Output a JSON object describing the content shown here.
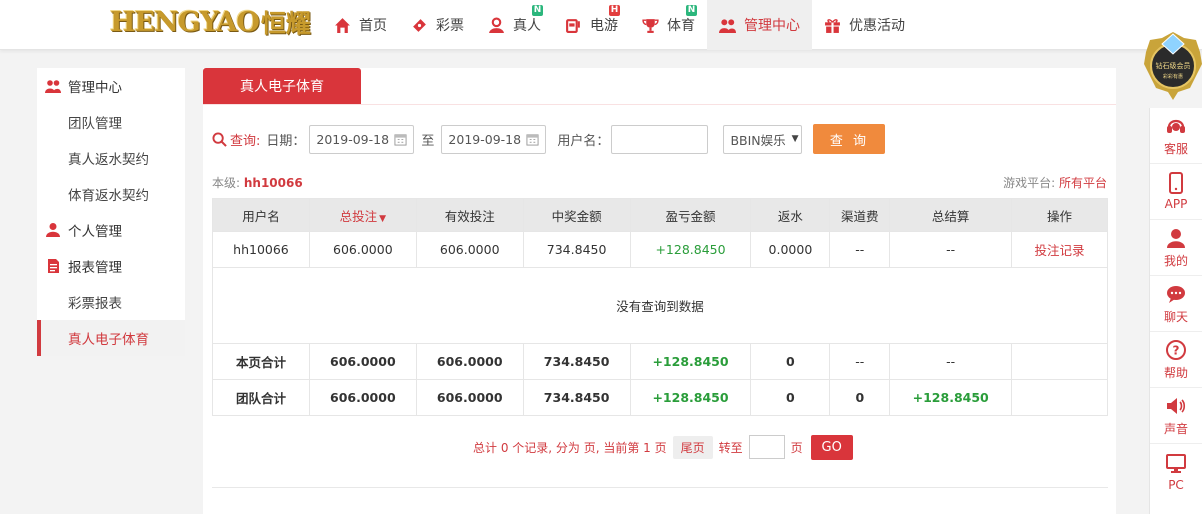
{
  "header": {
    "logo_text": "HENGYAO",
    "logo_cn": "恒耀",
    "nav": [
      {
        "label": "首页",
        "icon": "home-icon",
        "badge": ""
      },
      {
        "label": "彩票",
        "icon": "lottery-ticket-icon",
        "badge": ""
      },
      {
        "label": "真人",
        "icon": "live-dealer-icon",
        "badge": "N"
      },
      {
        "label": "电游",
        "icon": "slot-machine-icon",
        "badge": "H"
      },
      {
        "label": "体育",
        "icon": "trophy-icon",
        "badge": "N"
      },
      {
        "label": "管理中心",
        "icon": "users-icon",
        "badge": "",
        "active": true
      },
      {
        "label": "优惠活动",
        "icon": "gift-icon",
        "badge": ""
      }
    ]
  },
  "vip": {
    "line1": "钻石级会员",
    "line2": "彩彩有惠"
  },
  "sidebar": {
    "items": [
      {
        "label": "管理中心",
        "type": "group",
        "icon": "users-icon"
      },
      {
        "label": "团队管理",
        "type": "sub"
      },
      {
        "label": "真人返水契约",
        "type": "sub"
      },
      {
        "label": "体育返水契约",
        "type": "sub"
      },
      {
        "label": "个人管理",
        "type": "group",
        "icon": "user-icon"
      },
      {
        "label": "报表管理",
        "type": "group",
        "icon": "report-icon"
      },
      {
        "label": "彩票报表",
        "type": "sub"
      },
      {
        "label": "真人电子体育",
        "type": "sub",
        "current": true
      }
    ]
  },
  "main": {
    "tab_title": "真人电子体育",
    "filter": {
      "search_label": "查询:",
      "date_label": "日期：",
      "date_from": "2019-09-18",
      "to_label": "至",
      "date_to": "2019-09-18",
      "username_label": "用户名：",
      "username_value": "",
      "platform_value": "BBIN娱乐",
      "query_button": "查 询"
    },
    "level_label": "本级:",
    "level_value": "hh10066",
    "platform_label": "游戏平台:",
    "platform_all": "所有平台",
    "table": {
      "headers": [
        "用户名",
        "总投注",
        "有效投注",
        "中奖金额",
        "盈亏金额",
        "返水",
        "渠道费",
        "总结算",
        "操作"
      ],
      "sort_mark": "▼",
      "row": [
        "hh10066",
        "606.0000",
        "606.0000",
        "734.8450",
        "+128.8450",
        "0.0000",
        "--",
        "--",
        "投注记录"
      ],
      "empty_text": "没有查询到数据",
      "page_total": [
        "本页合计",
        "606.0000",
        "606.0000",
        "734.8450",
        "+128.8450",
        "0",
        "--",
        "--",
        ""
      ],
      "team_total": [
        "团队合计",
        "606.0000",
        "606.0000",
        "734.8450",
        "+128.8450",
        "0",
        "0",
        "+128.8450",
        ""
      ]
    },
    "pager": {
      "summary": "总计 0 个记录, 分为 页, 当前第 1 页",
      "last": "尾页",
      "goto_label": "转至",
      "page_unit": "页",
      "go_button": "GO",
      "goto_value": ""
    }
  },
  "rightbar": [
    {
      "label": "客服",
      "icon": "headset-icon"
    },
    {
      "label": "APP",
      "icon": "phone-icon"
    },
    {
      "label": "我的",
      "icon": "user-icon"
    },
    {
      "label": "聊天",
      "icon": "chat-icon"
    },
    {
      "label": "帮助",
      "icon": "help-icon"
    },
    {
      "label": "声音",
      "icon": "speaker-icon"
    },
    {
      "label": "PC",
      "icon": "monitor-icon"
    }
  ],
  "colors": {
    "accent": "#d9353b",
    "query_button": "#f08a3d",
    "positive": "#2a9d3a"
  }
}
